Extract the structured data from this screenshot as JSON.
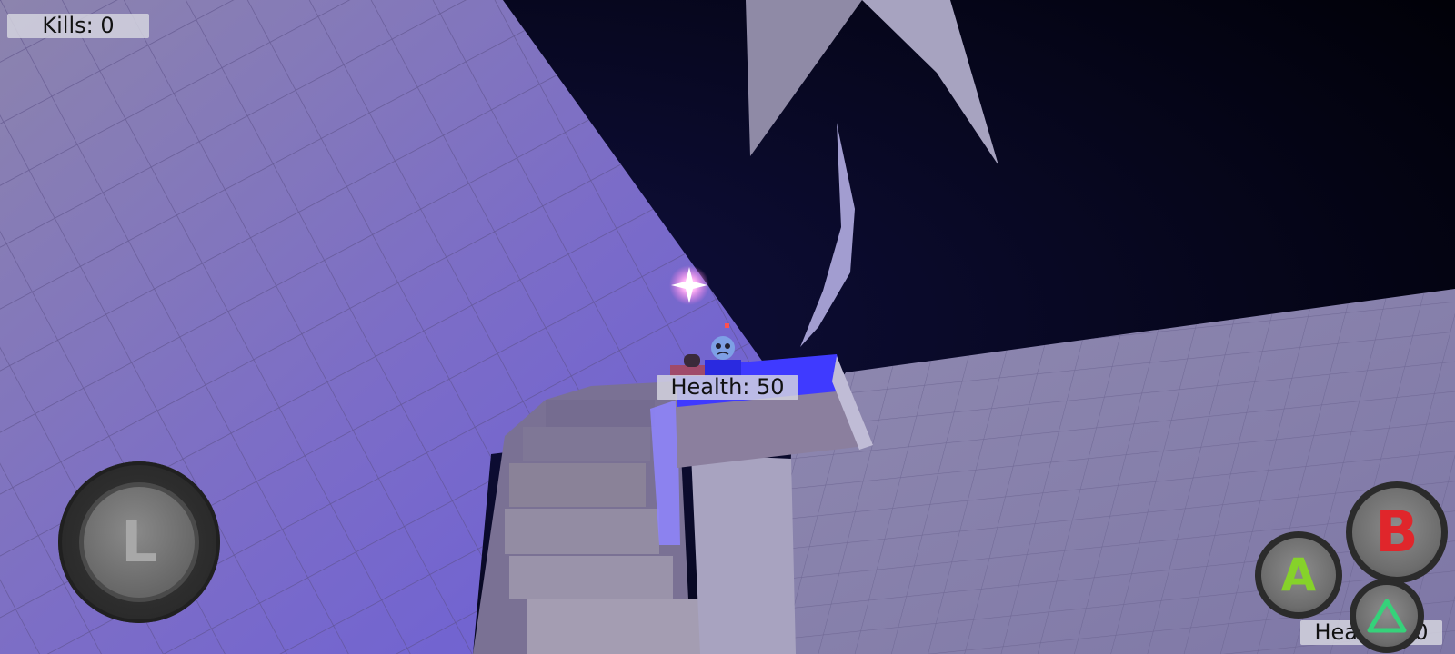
{
  "hud": {
    "kills_label": "Kills: 0",
    "enemy_health_label": "Health: 50",
    "player_health_label": "Health: 50"
  },
  "controls": {
    "joystick_label": "L",
    "b_button_label": "B",
    "a_button_label": "A",
    "triangle_button_icon": "triangle-icon"
  },
  "colors": {
    "sky": "#05051a",
    "wall": "#8a7fb8",
    "b_button": "#e0262b",
    "a_button": "#86d22a",
    "triangle_button": "#36d27a"
  }
}
